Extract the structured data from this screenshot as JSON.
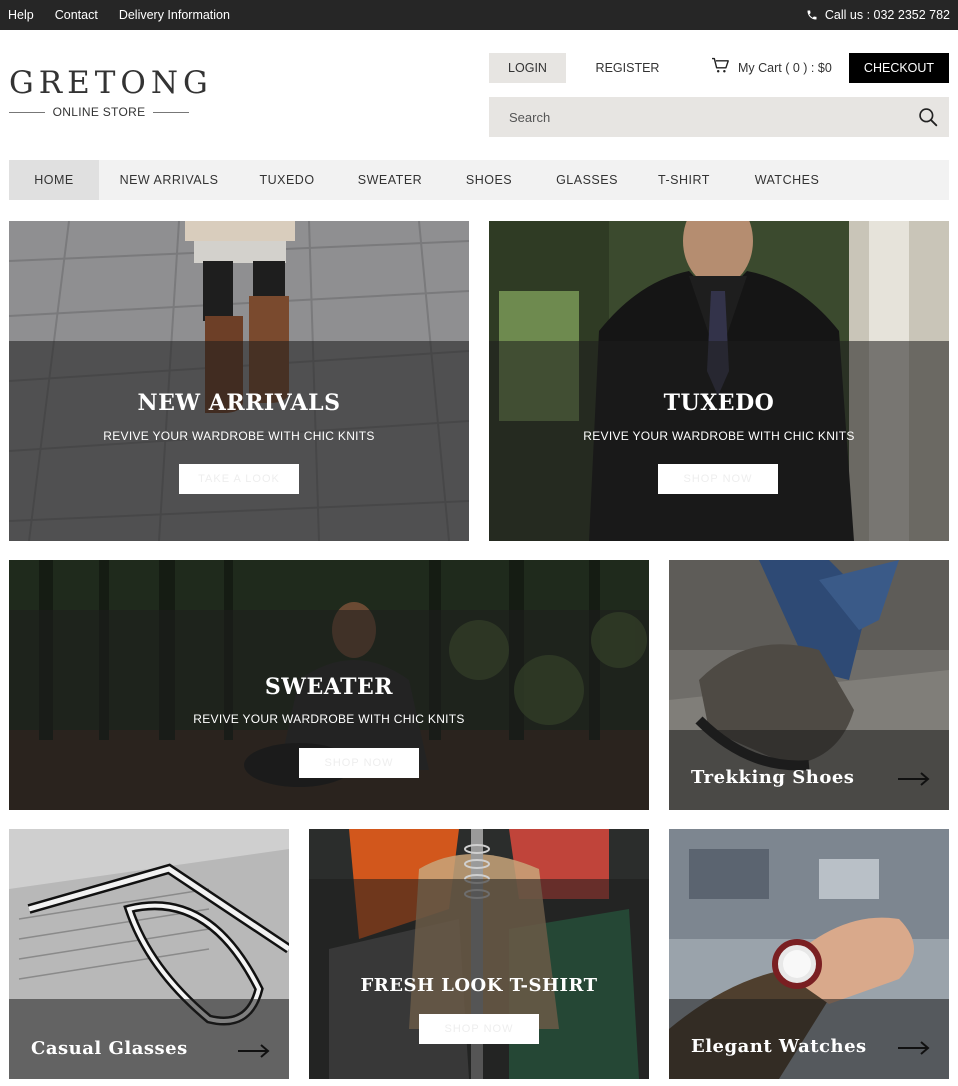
{
  "topbar": {
    "links": [
      "Help",
      "Contact",
      "Delivery Information"
    ],
    "call_text": "Call us : 032 2352 782"
  },
  "header": {
    "logo_name": "GRETONG",
    "logo_sub": "ONLINE STORE",
    "login": "LOGIN",
    "register": "REGISTER",
    "cart": "My Cart ( 0 ) : $0",
    "checkout": "CHECKOUT",
    "search_placeholder": "Search"
  },
  "nav": {
    "items": [
      "HOME",
      "NEW ARRIVALS",
      "TUXEDO",
      "SWEATER",
      "SHOES",
      "GLASSES",
      "T-SHIRT",
      "WATCHES"
    ],
    "active": "HOME"
  },
  "banners": {
    "new_arrivals": {
      "title": "NEW ARRIVALS",
      "subtitle": "REVIVE YOUR WARDROBE WITH CHIC KNITS",
      "button": "TAKE A LOOK"
    },
    "tuxedo": {
      "title": "TUXEDO",
      "subtitle": "REVIVE YOUR WARDROBE WITH CHIC KNITS",
      "button": "SHOP NOW"
    },
    "sweater": {
      "title": "SWEATER",
      "subtitle": "REVIVE YOUR WARDROBE WITH CHIC KNITS",
      "button": "SHOP NOW"
    },
    "shoes": {
      "title": "Trekking Shoes"
    },
    "glasses": {
      "title": "Casual Glasses"
    },
    "tshirt": {
      "title": "FRESH LOOK T-SHIRT",
      "button": "SHOP NOW"
    },
    "watches": {
      "title": "Elegant Watches"
    }
  },
  "colors": {
    "topbar_bg": "#262626",
    "checkout_bg": "#000000",
    "light_button_bg": "#e7e5e2",
    "nav_bg": "#f2f2f2",
    "nav_active_bg": "#e0e0e0"
  },
  "icons": [
    "phone-icon",
    "cart-icon",
    "search-icon",
    "arrow-right-icon"
  ]
}
